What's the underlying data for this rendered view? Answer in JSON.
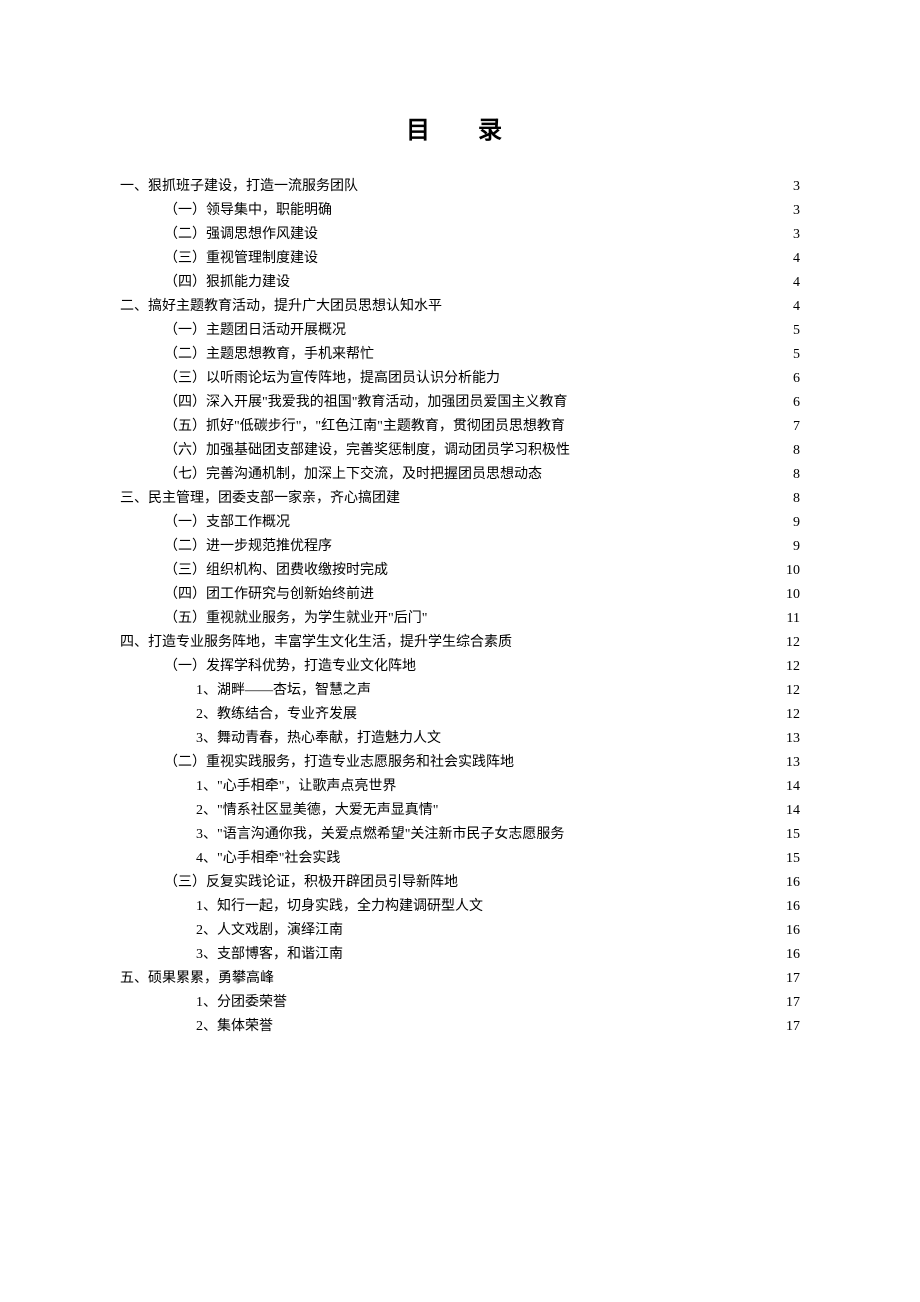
{
  "title": "目　录",
  "entries": [
    {
      "text": "一、狠抓班子建设，打造一流服务团队",
      "page": "3",
      "indent": 0
    },
    {
      "text": "（一）领导集中，职能明确",
      "page": "3",
      "indent": 1
    },
    {
      "text": "（二）强调思想作风建设",
      "page": "3",
      "indent": 1
    },
    {
      "text": "（三）重视管理制度建设",
      "page": "4",
      "indent": 1
    },
    {
      "text": "（四）狠抓能力建设",
      "page": "4",
      "indent": 1
    },
    {
      "text": "二、搞好主题教育活动，提升广大团员思想认知水平",
      "page": "4",
      "indent": 0
    },
    {
      "text": "（一）主题团日活动开展概况",
      "page": "5",
      "indent": 1
    },
    {
      "text": "（二）主题思想教育，手机来帮忙",
      "page": "5",
      "indent": 1
    },
    {
      "text": "（三）以听雨论坛为宣传阵地，提高团员认识分析能力",
      "page": "6",
      "indent": 1
    },
    {
      "text": "（四）深入开展\"我爱我的祖国\"教育活动，加强团员爱国主义教育",
      "page": "6",
      "indent": 1
    },
    {
      "text": "（五）抓好\"低碳步行\"，\"红色江南\"主题教育，贯彻团员思想教育",
      "page": "7",
      "indent": 1
    },
    {
      "text": "（六）加强基础团支部建设，完善奖惩制度，调动团员学习积极性",
      "page": "8",
      "indent": 1
    },
    {
      "text": "（七）完善沟通机制，加深上下交流，及时把握团员思想动态",
      "page": "8",
      "indent": 1
    },
    {
      "text": "三、民主管理，团委支部一家亲，齐心搞团建",
      "page": "8",
      "indent": 0
    },
    {
      "text": "（一）支部工作概况",
      "page": "9",
      "indent": 1
    },
    {
      "text": "（二）进一步规范推优程序",
      "page": "9",
      "indent": 1
    },
    {
      "text": "（三）组织机构、团费收缴按时完成",
      "page": "10",
      "indent": 1
    },
    {
      "text": "（四）团工作研究与创新始终前进",
      "page": "10",
      "indent": 1
    },
    {
      "text": "（五）重视就业服务，为学生就业开\"后门\"",
      "page": "11",
      "indent": 1
    },
    {
      "text": "四、打造专业服务阵地，丰富学生文化生活，提升学生综合素质",
      "page": "12",
      "indent": 0
    },
    {
      "text": "（一）发挥学科优势，打造专业文化阵地",
      "page": "12",
      "indent": 1
    },
    {
      "text": "1、湖畔——杏坛，智慧之声",
      "page": "12",
      "indent": 2
    },
    {
      "text": "2、教练结合，专业齐发展",
      "page": "12",
      "indent": 2
    },
    {
      "text": "3、舞动青春，热心奉献，打造魅力人文",
      "page": "13",
      "indent": 2
    },
    {
      "text": "（二）重视实践服务，打造专业志愿服务和社会实践阵地",
      "page": "13",
      "indent": 1
    },
    {
      "text": "1、\"心手相牵\"，让歌声点亮世界",
      "page": "14",
      "indent": 2
    },
    {
      "text": "2、\"情系社区显美德，大爱无声显真情\"",
      "page": "14",
      "indent": 2
    },
    {
      "text": "3、\"语言沟通你我，关爱点燃希望\"关注新市民子女志愿服务",
      "page": "15",
      "indent": 2
    },
    {
      "text": "4、\"心手相牵\"社会实践",
      "page": "15",
      "indent": 2
    },
    {
      "text": "（三）反复实践论证，积极开辟团员引导新阵地",
      "page": "16",
      "indent": 1
    },
    {
      "text": "1、知行一起，切身实践，全力构建调研型人文",
      "page": "16",
      "indent": 2
    },
    {
      "text": "2、人文戏剧，演绎江南",
      "page": "16",
      "indent": 2
    },
    {
      "text": "3、支部博客，和谐江南",
      "page": "16",
      "indent": 2
    },
    {
      "text": "五、硕果累累，勇攀高峰",
      "page": "17",
      "indent": 0
    },
    {
      "text": "1、分团委荣誉",
      "page": "17",
      "indent": 2
    },
    {
      "text": "2、集体荣誉",
      "page": "17",
      "indent": 2
    }
  ]
}
